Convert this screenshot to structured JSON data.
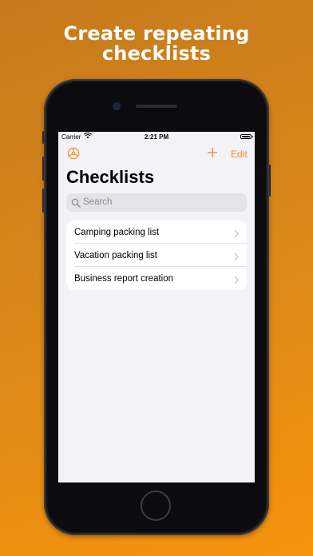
{
  "headline": {
    "line1": "Create repeating",
    "line2": "checklists"
  },
  "status_bar": {
    "carrier": "Carrier",
    "time": "2:21 PM",
    "wifi_icon": "wifi-icon",
    "battery_icon": "battery-icon"
  },
  "nav": {
    "left_icon": "settings-wheel-icon",
    "add_icon": "plus-icon",
    "edit_label": "Edit"
  },
  "page": {
    "title": "Checklists"
  },
  "search": {
    "placeholder": "Search",
    "icon": "search-icon"
  },
  "checklists": [
    {
      "label": "Camping packing list"
    },
    {
      "label": "Vacation packing list"
    },
    {
      "label": "Business report creation"
    }
  ],
  "colors": {
    "accent": "#f0912d",
    "background_gradient_start": "#c57a1c",
    "background_gradient_end": "#f6930d",
    "screen_background": "#f2f2f7"
  }
}
